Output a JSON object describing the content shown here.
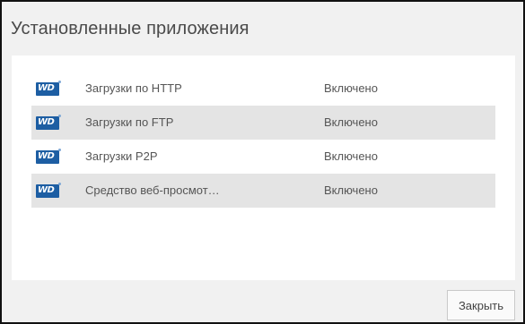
{
  "dialog": {
    "title": "Установленные приложения",
    "close_label": "Закрыть"
  },
  "apps": [
    {
      "logo": "WD",
      "name": "Загрузки по HTTP",
      "status": "Включено"
    },
    {
      "logo": "WD",
      "name": "Загрузки по FTP",
      "status": "Включено"
    },
    {
      "logo": "WD",
      "name": "Загрузки P2P",
      "status": "Включено"
    },
    {
      "logo": "WD",
      "name": "Средство веб-просмот…",
      "status": "Включено"
    }
  ],
  "colors": {
    "logo_blue": "#1d5ea3",
    "row_alt": "#e4e4e4",
    "dialog_bg": "#f1f1f1"
  }
}
